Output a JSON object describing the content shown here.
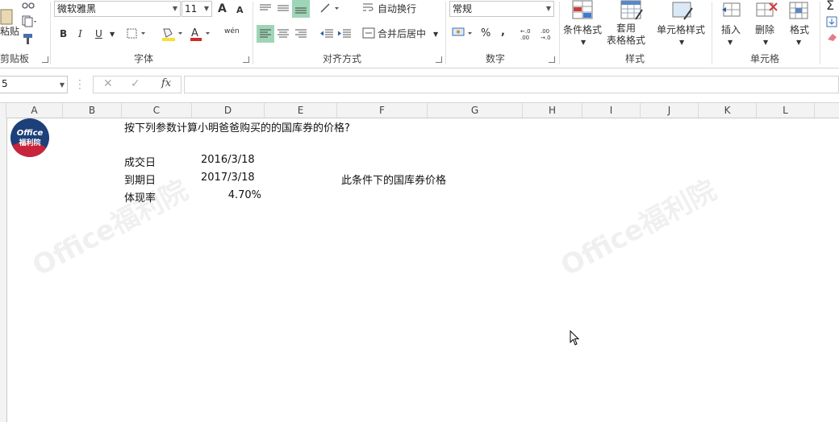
{
  "ribbon": {
    "clipboard": {
      "paste_label": "粘贴",
      "group_label": "剪贴板"
    },
    "font": {
      "font_name": "微软雅黑",
      "font_size": "11",
      "bold": "B",
      "italic": "I",
      "underline": "U",
      "grow_label": "A",
      "shrink_label": "A",
      "phonetic_label": "wén",
      "group_label": "字体"
    },
    "alignment": {
      "wrap_label": "自动换行",
      "merge_label": "合并后居中",
      "group_label": "对齐方式"
    },
    "number": {
      "format": "常规",
      "percent": "%",
      "comma": ",",
      "inc_dec": "←.0 .00",
      "dec_dec": ".00 →.0",
      "group_label": "数字"
    },
    "styles": {
      "conditional_label": "条件格式",
      "table_label": "套用\n表格格式",
      "cell_styles_label": "单元格样式",
      "group_label": "样式"
    },
    "cells": {
      "insert_label": "插入",
      "delete_label": "删除",
      "format_label": "格式",
      "group_label": "单元格"
    },
    "editing": {
      "sum_label": "Σ"
    }
  },
  "formula_bar": {
    "name_box": "5",
    "fx_label": "fx",
    "content": ""
  },
  "columns": [
    "A",
    "B",
    "C",
    "D",
    "E",
    "F",
    "G",
    "H",
    "I",
    "J",
    "K",
    "L"
  ],
  "sheet": {
    "title": "按下列参数计算小明爸爸购买的的国库券的价格?",
    "rows": [
      {
        "label": "成交日",
        "value": "2016/3/18"
      },
      {
        "label": "到期日",
        "value": "2017/3/18"
      },
      {
        "label": "体现率",
        "value": "4.70%"
      }
    ],
    "note": "此条件下的国库券价格"
  },
  "logo": {
    "line1": "Office",
    "line2": "福利院"
  },
  "watermark_text": "Office福利院",
  "colors": {
    "active_align": "#9fd5b7",
    "logo_bg": "#1d3f7a",
    "logo_accent": "#c8243b"
  }
}
